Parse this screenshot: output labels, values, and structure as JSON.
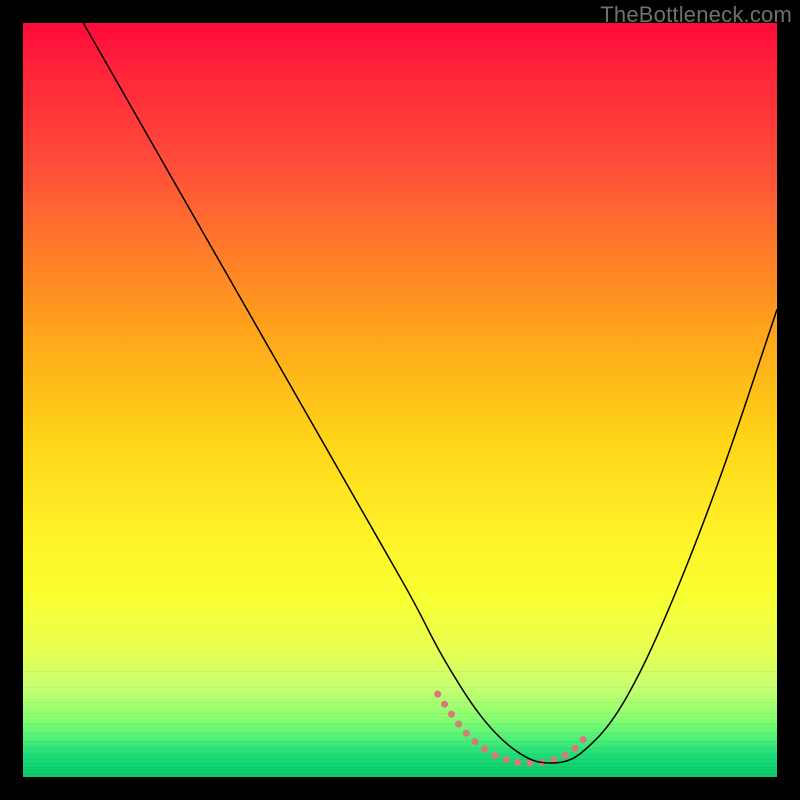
{
  "watermark": "TheBottleneck.com",
  "chart_data": {
    "type": "line",
    "title": "",
    "xlabel": "",
    "ylabel": "",
    "xlim": [
      0,
      100
    ],
    "ylim": [
      0,
      100
    ],
    "grid": false,
    "legend": false,
    "background_gradient": {
      "orientation": "vertical",
      "stops": [
        {
          "pos": 0,
          "color": "#ff0a3a"
        },
        {
          "pos": 30,
          "color": "#ff7a2a"
        },
        {
          "pos": 55,
          "color": "#ffd418"
        },
        {
          "pos": 76,
          "color": "#f8ff30"
        },
        {
          "pos": 92,
          "color": "#8cff70"
        },
        {
          "pos": 100,
          "color": "#0acb6a"
        }
      ]
    },
    "series": [
      {
        "name": "bottleneck-curve",
        "color": "#000000",
        "stroke_width": 1.5,
        "x": [
          8,
          12,
          16,
          20,
          24,
          28,
          32,
          36,
          40,
          44,
          48,
          52,
          55,
          58,
          60,
          62,
          64,
          66,
          68,
          70,
          72,
          74,
          78,
          82,
          86,
          90,
          94,
          98,
          100
        ],
        "y": [
          100,
          93,
          86,
          79,
          72,
          65,
          58,
          51,
          44,
          37,
          30,
          23,
          17,
          12,
          9,
          6.5,
          4.5,
          3,
          2,
          1.8,
          2,
          3,
          7,
          14,
          23,
          33,
          44,
          56,
          62
        ]
      }
    ],
    "highlight": {
      "name": "valley-highlight",
      "color": "#d77a7a",
      "stroke_width": 7,
      "dash": [
        0.1,
        12
      ],
      "linecap": "round",
      "x": [
        55,
        57,
        59,
        61,
        63,
        65,
        67,
        69,
        71,
        73,
        74.5
      ],
      "y": [
        11,
        8,
        5.5,
        3.8,
        2.6,
        2.0,
        1.8,
        1.9,
        2.4,
        3.5,
        5.2
      ]
    },
    "bottom_bands_y_percent": [
      86,
      88,
      90,
      91.5,
      93,
      94.2,
      95.2,
      96.1,
      96.9,
      97.6,
      98.2,
      98.7,
      99.1,
      99.5
    ]
  }
}
